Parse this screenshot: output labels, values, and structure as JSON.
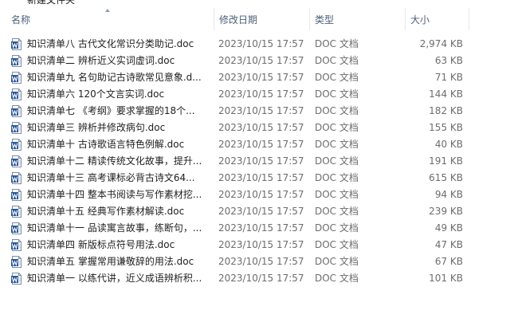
{
  "partial_row_above": "新建文件夹",
  "columns": {
    "name": "名称",
    "date": "修改日期",
    "type": "类型",
    "size": "大小"
  },
  "files": [
    {
      "name": "知识清单八   古代文化常识分类助记.doc",
      "date": "2023/10/15 17:57",
      "type": "DOC 文档",
      "size": "2,974 KB"
    },
    {
      "name": "知识清单二   辨析近义实词虚词.doc",
      "date": "2023/10/15 17:57",
      "type": "DOC 文档",
      "size": "63 KB"
    },
    {
      "name": "知识清单九   名句助记古诗歌常见意象.d...",
      "date": "2023/10/15 17:57",
      "type": "DOC 文档",
      "size": "71 KB"
    },
    {
      "name": "知识清单六   120个文言实词.doc",
      "date": "2023/10/15 17:57",
      "type": "DOC 文档",
      "size": "144 KB"
    },
    {
      "name": "知识清单七   《考纲》要求掌握的18个...",
      "date": "2023/10/15 17:57",
      "type": "DOC 文档",
      "size": "182 KB"
    },
    {
      "name": "知识清单三   辨析并修改病句.doc",
      "date": "2023/10/15 17:57",
      "type": "DOC 文档",
      "size": "155 KB"
    },
    {
      "name": "知识清单十   古诗歌语言特色例解.doc",
      "date": "2023/10/15 17:57",
      "type": "DOC 文档",
      "size": "40 KB"
    },
    {
      "name": "知识清单十二   精读传统文化故事，提升...",
      "date": "2023/10/15 17:57",
      "type": "DOC 文档",
      "size": "191 KB"
    },
    {
      "name": "知识清单十三   高考课标必背古诗文64...",
      "date": "2023/10/15 17:57",
      "type": "DOC 文档",
      "size": "615 KB"
    },
    {
      "name": "知识清单十四   整本书阅读与写作素材挖...",
      "date": "2023/10/15 17:57",
      "type": "DOC 文档",
      "size": "94 KB"
    },
    {
      "name": "知识清单十五   经典写作素材解读.doc",
      "date": "2023/10/15 17:57",
      "type": "DOC 文档",
      "size": "239 KB"
    },
    {
      "name": "知识清单十一   品读寓言故事，练断句，...",
      "date": "2023/10/15 17:57",
      "type": "DOC 文档",
      "size": "49 KB"
    },
    {
      "name": "知识清单四   新版标点符号用法.doc",
      "date": "2023/10/15 17:57",
      "type": "DOC 文档",
      "size": "47 KB"
    },
    {
      "name": "知识清单五   掌握常用谦敬辞的用法.doc",
      "date": "2023/10/15 17:57",
      "type": "DOC 文档",
      "size": "67 KB"
    },
    {
      "name": "知识清单一   以练代讲，近义成语辨析积...",
      "date": "2023/10/15 17:57",
      "type": "DOC 文档",
      "size": "101 KB"
    }
  ],
  "icon": "word-document-icon",
  "colors": {
    "header_text": "#4c607a",
    "icon_blue": "#2b5797"
  }
}
